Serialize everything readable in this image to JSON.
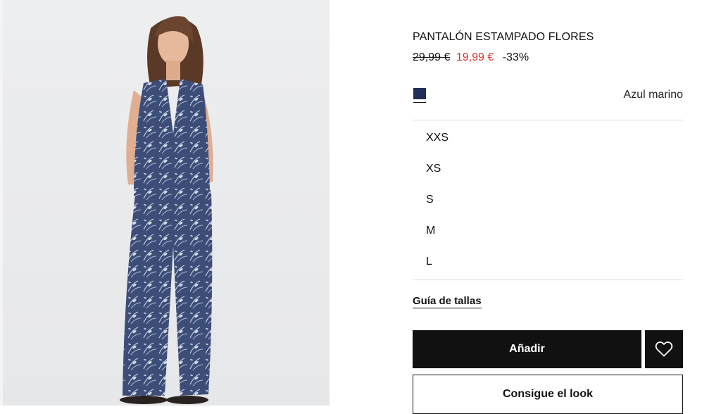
{
  "product": {
    "title": "PANTALÓN ESTAMPADO FLORES",
    "price_old": "29,99 €",
    "price_new": "19,99 €",
    "discount": "-33%",
    "color": {
      "name": "Azul marino",
      "swatch_hex": "#1f2f5a"
    }
  },
  "sizes": [
    "XXS",
    "XS",
    "S",
    "M",
    "L"
  ],
  "size_guide_label": "Guía de tallas",
  "actions": {
    "add_label": "Añadir",
    "look_label": "Consigue el look",
    "wishlist_icon": "heart-icon"
  },
  "colors": {
    "sale_price": "#d9322b",
    "button_dark": "#111111"
  }
}
